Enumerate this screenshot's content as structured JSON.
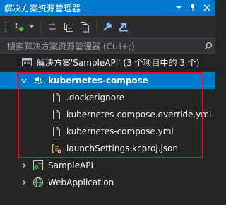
{
  "window": {
    "title": "解决方案资源管理器",
    "controls": [
      "dropdown-icon",
      "pin-icon",
      "close-icon"
    ]
  },
  "toolbar": {
    "buttons": [
      "sync-icon",
      "refresh-icon",
      "collapse-all-icon",
      "show-all-files-icon",
      "properties-icon",
      "preview-icon"
    ]
  },
  "search": {
    "placeholder": "搜索解决方案资源管理器 (Ctrl+;)"
  },
  "tree": {
    "solution": {
      "label": "解决方案'SampleAPI' (3 个项目中的 3 个)"
    },
    "compose_project": {
      "label": "kubernetes-compose",
      "expanded": true,
      "selected": true
    },
    "compose_files": [
      {
        "label": ".dockerignore",
        "icon": "file-icon"
      },
      {
        "label": "kubernetes-compose.override.yml",
        "icon": "file-icon"
      },
      {
        "label": "kubernetes-compose.yml",
        "icon": "file-icon"
      },
      {
        "label": "launchSettings.kcproj.json",
        "icon": "json-settings-icon"
      }
    ],
    "projects": [
      {
        "label": "SampleAPI",
        "icon": "csharp-project-icon"
      },
      {
        "label": "WebApplication",
        "icon": "web-project-icon"
      }
    ]
  },
  "colors": {
    "accent": "#007acc",
    "highlight_border": "#e81123",
    "background": "#252526"
  }
}
